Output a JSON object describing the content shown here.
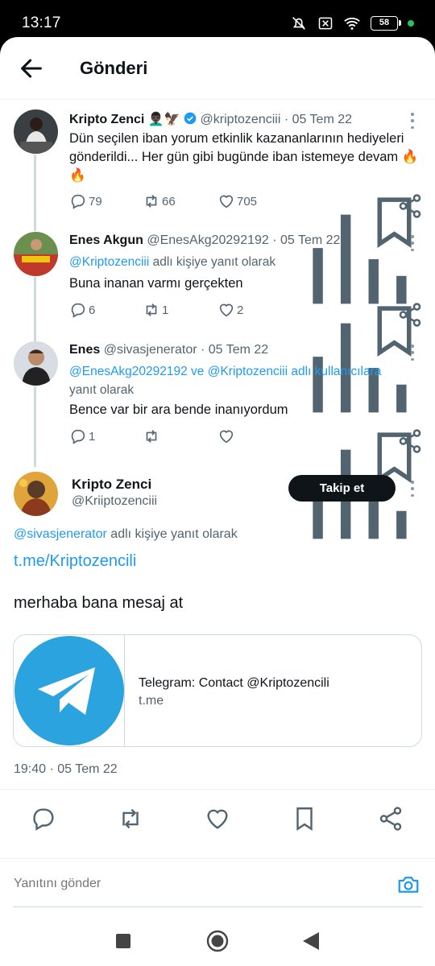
{
  "status": {
    "time": "13:17",
    "battery": "58"
  },
  "header": {
    "title": "Gönderi"
  },
  "tweets": [
    {
      "name": "Kripto Zenci",
      "emoji": "👨🏿‍🦱🦅",
      "handle": "@kriptozenciii",
      "date": "· 05 Tem 22",
      "text": "Dün seçilen iban yorum etkinlik kazananlarının hediyeleri gönderildi... Her gün gibi bugünde iban istemeye devam 🔥🔥",
      "replies": "79",
      "retweets": "66",
      "likes": "705"
    },
    {
      "name": "Enes Akgun",
      "handle": "@EnesAkg20292192",
      "date": "· 05 Tem 22",
      "reply_mention": "@Kriptozenciii",
      "reply_suffix": " adlı kişiye yanıt olarak",
      "text": "Buna inanan varmı gerçekten",
      "replies": "6",
      "retweets": "1",
      "likes": "2"
    },
    {
      "name": "Enes",
      "handle": "@sivasjenerator",
      "date": "· 05 Tem 22",
      "reply_mention1": "@EnesAkg20292192",
      "reply_and": " ve ",
      "reply_mention2": "@Kriptozenciii",
      "reply_suffix_blue": " adlı kullanıcılara",
      "reply_suffix": "yanıt olarak",
      "text": "Bence var bir ara bende inanıyordum",
      "replies": "1",
      "retweets": "",
      "likes": ""
    }
  ],
  "main": {
    "name": "Kripto Zenci",
    "handle": "@Kriiptozenciii",
    "follow_label": "Takip et",
    "reply_mention": "@sivasjenerator",
    "reply_suffix": " adlı kişiye yanıt olarak",
    "link": "t.me/Kriptozencili",
    "text": "merhaba bana mesaj at",
    "card_title": "Telegram: Contact @Kriptozencili",
    "card_domain": "t.me",
    "timestamp": "19:40 · 05 Tem 22"
  },
  "reply_box": {
    "placeholder": "Yanıtını gönder"
  },
  "colors": {
    "accent": "#1d9bf0",
    "text": "#0f1419",
    "muted": "#536471",
    "telegram": "#2aa3df"
  }
}
